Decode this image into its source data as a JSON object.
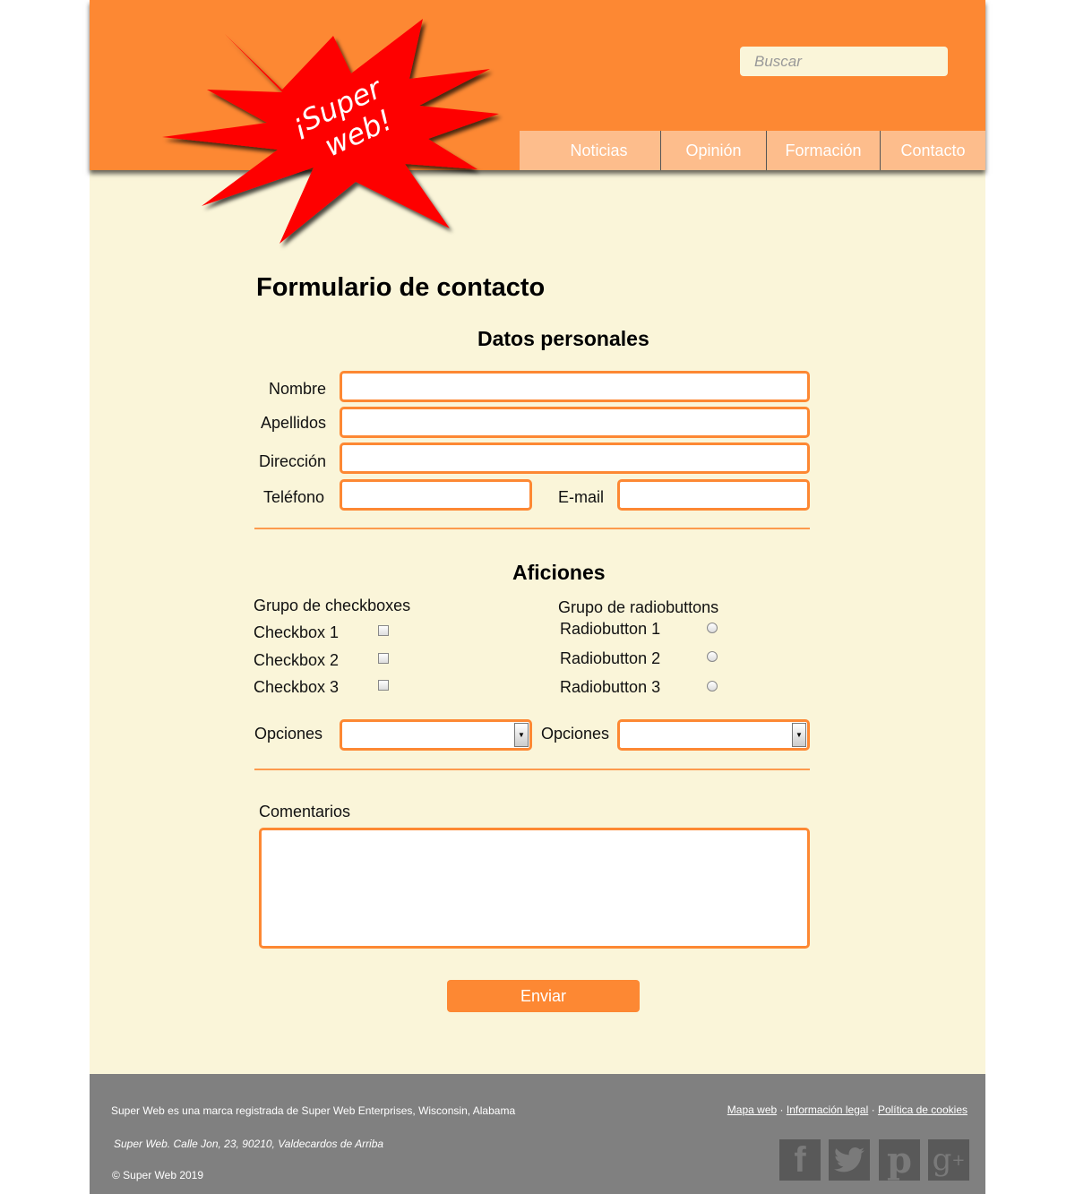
{
  "header": {
    "logo_text": [
      "¡Super",
      "web!"
    ],
    "search": {
      "placeholder": "Buscar"
    },
    "nav": [
      "Noticias",
      "Opinión",
      "Formación",
      "Contacto"
    ]
  },
  "form": {
    "title": "Formulario de contacto",
    "personal": {
      "heading": "Datos personales",
      "nombre": "Nombre",
      "apellidos": "Apellidos",
      "direccion": "Dirección",
      "telefono": "Teléfono",
      "email": "E-mail"
    },
    "hobbies": {
      "heading": "Aficiones",
      "checkbox_group": "Grupo de checkboxes",
      "checkboxes": [
        "Checkbox 1",
        "Checkbox 2",
        "Checkbox 3"
      ],
      "radio_group": "Grupo de radiobuttons",
      "radios": [
        "Radiobutton 1",
        "Radiobutton 2",
        "Radiobutton 3"
      ],
      "options1": "Opciones",
      "options2": "Opciones"
    },
    "comments": "Comentarios",
    "submit": "Enviar"
  },
  "footer": {
    "trademark": "Super Web es una marca registrada de Super Web Enterprises, Wisconsin, Alabama",
    "address": "Super Web. Calle Jon, 23, 90210, Valdecardos de Arriba",
    "copyright": "© Super Web 2019",
    "links": [
      "Mapa web",
      "Información legal",
      "Política de cookies"
    ],
    "separator": "·",
    "social": [
      "facebook-icon",
      "twitter-icon",
      "pinterest-icon",
      "google-plus-icon"
    ]
  },
  "colors": {
    "accent": "#fd8833",
    "background": "#faf5d9",
    "footer": "#808080",
    "star": "#ff0000"
  }
}
